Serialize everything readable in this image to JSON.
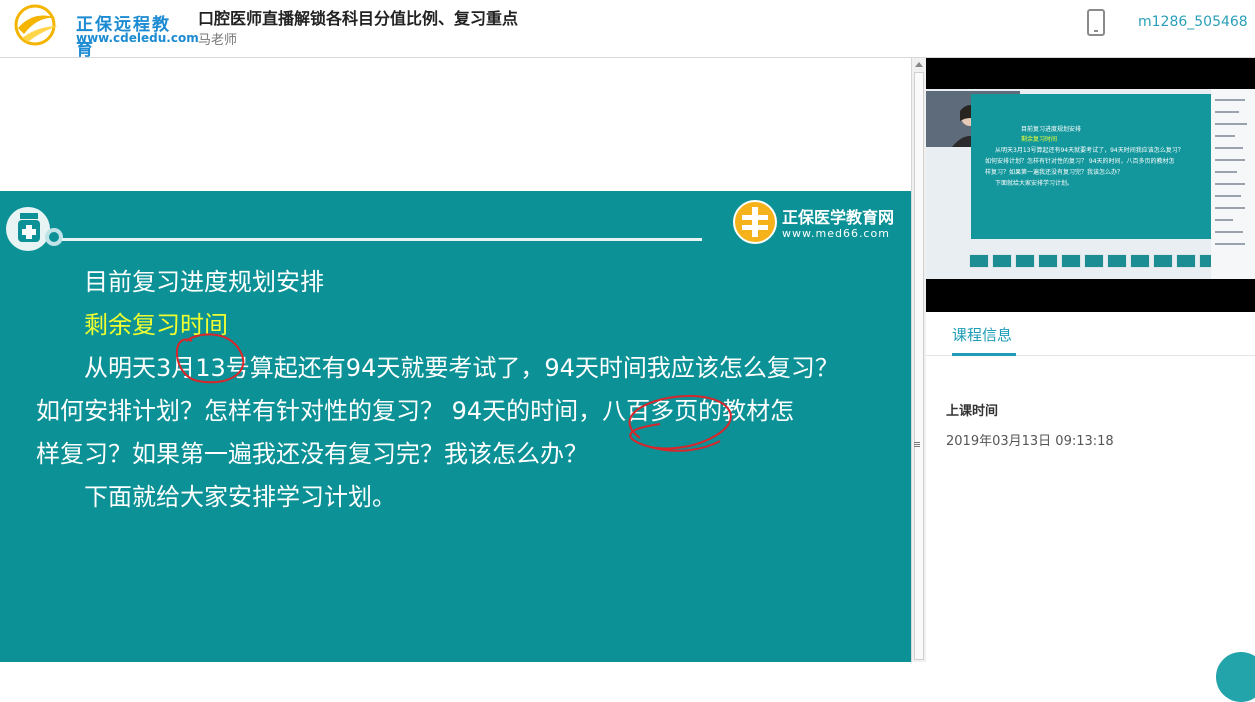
{
  "header": {
    "logo_name": "正保远程教育",
    "logo_url": "www.cdeledu.com",
    "course_title": "口腔医师直播解锁各科目分值比例、复习重点",
    "teacher": "马老师",
    "user_id": "m1286_505468",
    "phone_icon": "mobile-phone-icon"
  },
  "slide": {
    "brand_name": "正保医学教育网",
    "brand_url": "www.med66.com",
    "lines": [
      "目前复习进度规划安排",
      "剩余复习时间",
      "从明天3月13号算起还有94天就要考试了，94天时间我应该怎么复习？",
      "如何安排计划？怎样有针对性的复习？ 94天的时间，八百多页的教材怎",
      "样复习？如果第一遍我还没有复习完？我该怎么办？",
      "下面就给大家安排学习计划。"
    ],
    "colors": {
      "background": "#0b9196",
      "highlight": "#f0ff2f",
      "annotation": "#d8262b"
    }
  },
  "video": {
    "mini_lines": [
      "目前复习进度规划安排",
      "剩余复习时间",
      "从明天3月13号算起还有94天就要考试了，94天时间我应该怎么复习？",
      "如何安排计划？怎样有针对性的复习？ 94天的时间，八百多页的教材怎",
      "样复习？如果第一遍我还没有复习完？我该怎么办？",
      "下面就给大家安排学习计划。"
    ]
  },
  "panel": {
    "tab_label": "课程信息",
    "class_time_label": "上课时间",
    "class_time_value": "2019年03月13日 09:13:18"
  }
}
